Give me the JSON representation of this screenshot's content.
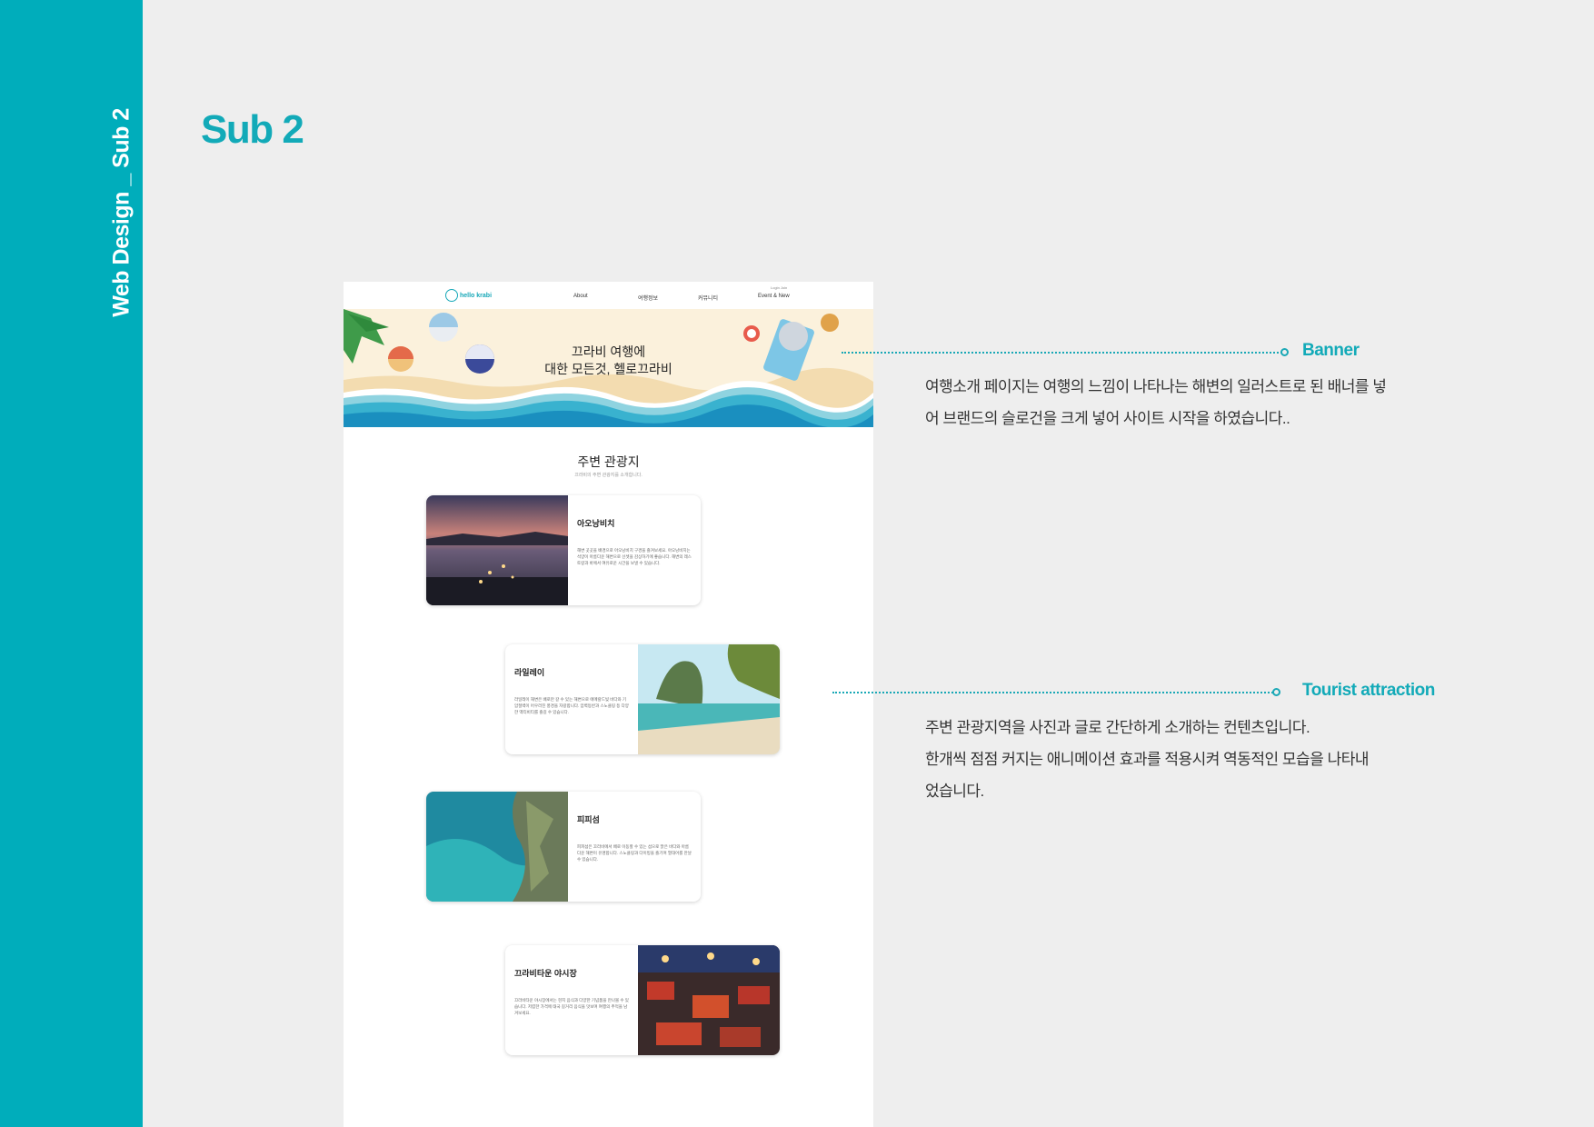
{
  "sidebar": {
    "title": "Web Design _ Sub 2"
  },
  "page": {
    "heading": "Sub 2"
  },
  "mockup": {
    "logo_text": "hello krabi",
    "login": "Login  Join",
    "nav": [
      "About",
      "여행정보",
      "커뮤니티",
      "Event & New"
    ],
    "banner_text_line1": "끄라비 여행에",
    "banner_text_line2": "대한 모든것, 헬로끄라비",
    "section_title": "주변 관광지",
    "section_sub": "끄라비의 주변 관광지를 소개합니다.",
    "cards": [
      {
        "title": "아오낭비치",
        "desc": "해변 곳곳을 배경으로 아오낭비치 구경을 즐겨보세요. 아오낭비치는 석양이 아름다운 해변으로 선셋을 감상하기에 좋습니다. 해변의 레스토랑과 바에서 여유로운 시간을 보낼 수 있습니다."
      },
      {
        "title": "라일레이",
        "desc": "라일레이 해변은 배로만 갈 수 있는 해변으로 에메랄드빛 바다와 기암절벽이 어우러진 풍경을 자랑합니다. 암벽등반과 스노클링 등 다양한 액티비티를 즐길 수 있습니다."
      },
      {
        "title": "피피섬",
        "desc": "피피섬은 끄라비에서 배로 이동할 수 있는 섬으로 맑은 바다와 아름다운 해변이 유명합니다. 스노클링과 다이빙을 즐기며 열대어를 만날 수 있습니다."
      },
      {
        "title": "끄라비타운 야시장",
        "desc": "끄라비타운 야시장에서는 현지 음식과 다양한 기념품을 만나볼 수 있습니다. 저렴한 가격에 태국 길거리 음식을 맛보며 여행의 추억을 남겨보세요."
      }
    ]
  },
  "annotations": {
    "banner": {
      "label": "Banner",
      "lines": [
        "여행소개 페이지는 여행의 느낌이 나타나는 해변의 일러스트로 된 배너를 넣",
        "어 브랜드의 슬로건을 크게 넣어 사이트 시작을 하였습니다.."
      ]
    },
    "tourist": {
      "label": "Tourist attraction",
      "lines": [
        "주변 관광지역을  사진과 글로 간단하게 소개하는 컨텐츠입니다.",
        "한개씩 점점 커지는 애니메이션 효과를 적용시켜 역동적인 모습을 나타내",
        "었습니다."
      ]
    }
  },
  "colors": {
    "accent": "#00adbb",
    "background": "#eeeeee"
  }
}
